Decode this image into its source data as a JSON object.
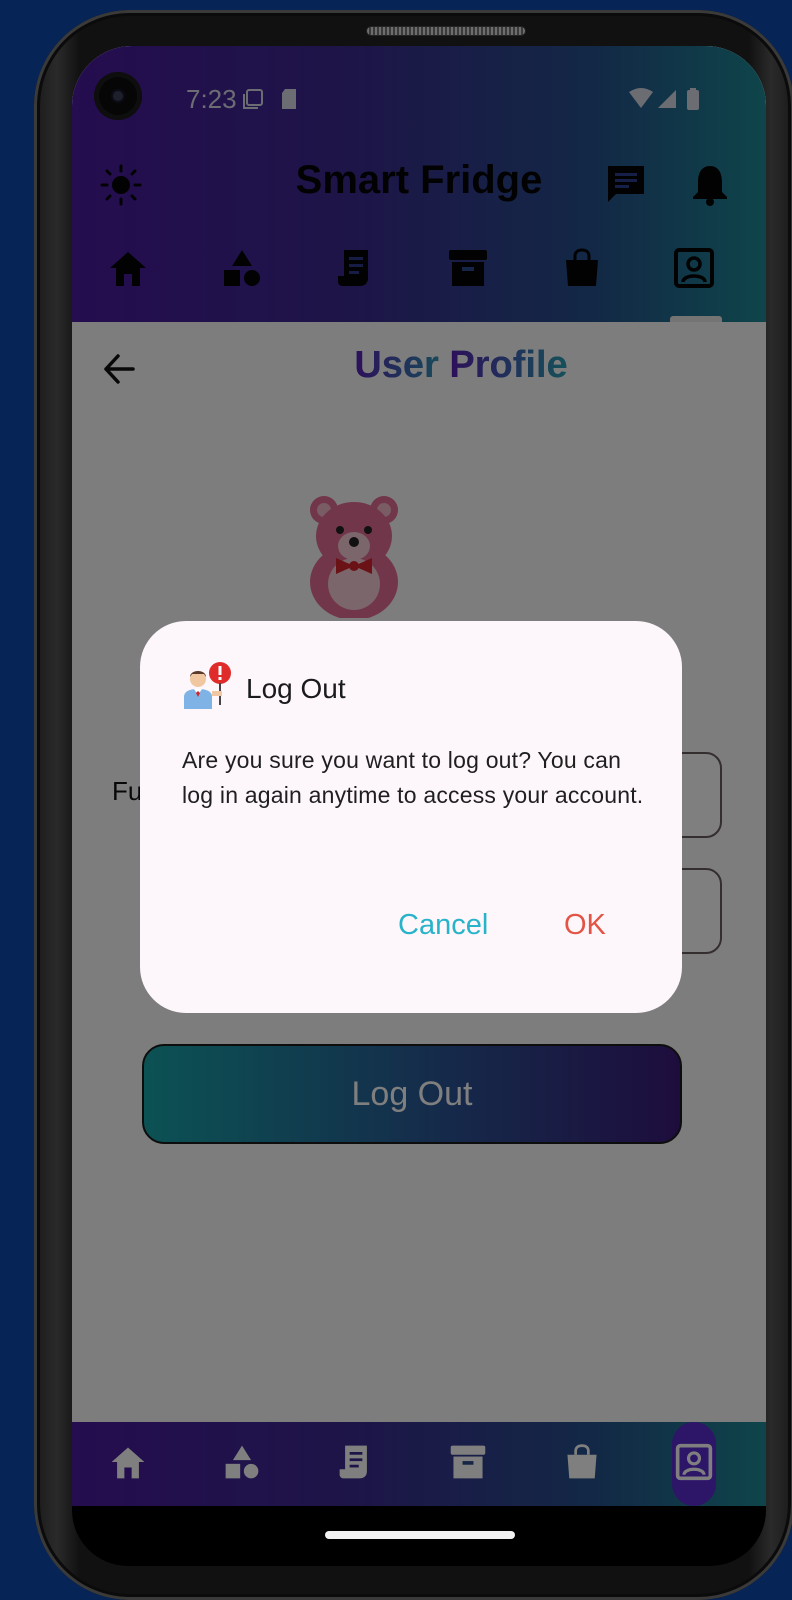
{
  "status_bar": {
    "time": "7:23"
  },
  "header": {
    "title": "Smart Fridge"
  },
  "page": {
    "title_part1": "User ",
    "title_part2": "Profile"
  },
  "profile": {
    "field_label_partial": "Fu"
  },
  "actions": {
    "logout_button": "Log Out"
  },
  "dialog": {
    "title": "Log Out",
    "message": "Are you sure you want to log out? You can log in again anytime to access your account.",
    "cancel_label": "Cancel",
    "ok_label": "OK"
  },
  "tabs": [
    {
      "icon": "home-icon"
    },
    {
      "icon": "shapes-icon"
    },
    {
      "icon": "receipt-icon"
    },
    {
      "icon": "archive-icon"
    },
    {
      "icon": "shopping-bag-icon"
    },
    {
      "icon": "profile-icon"
    }
  ],
  "colors": {
    "header_gradient_start": "#4a1a9e",
    "header_gradient_end": "#1d8a95",
    "cancel": "#27b3c9",
    "ok": "#e25545",
    "background": "#062456"
  }
}
